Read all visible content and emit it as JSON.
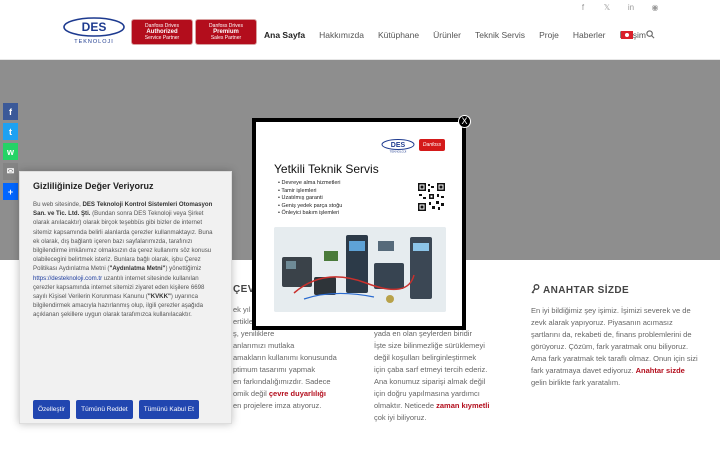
{
  "header": {
    "logo_text": "DES TEKNOLOJI",
    "badges": [
      {
        "line1": "Danfoss Drives",
        "line2": "Authorized",
        "line3": "Service Partner"
      },
      {
        "line1": "Danfoss Drives",
        "line2": "Premium",
        "line3": "Sales Partner"
      }
    ],
    "nav": [
      "Ana Sayfa",
      "Hakkımızda",
      "Kütüphane",
      "Ürünler",
      "Teknik Servis",
      "Proje",
      "Haberler",
      "İletişim"
    ],
    "active_nav": "Ana Sayfa",
    "social": [
      "f",
      "𝕏",
      "in",
      "rss"
    ]
  },
  "share": [
    "f",
    "t",
    "w",
    "✉",
    "+"
  ],
  "cookie": {
    "title": "Gizliliğinize Değer Veriyoruz",
    "p1a": "Bu web sitesinde, ",
    "p1b": "DES Teknoloji Kontrol Sistemleri Otomasyon San. ve Tic. Ltd. Şti.",
    "p1c": " (Bundan sonra DES Teknoloji veya Şirket olarak anılacaktır) olarak birçok teşebbüs gibi bizler de internet sitemiz kapsamında belirli alanlarda çerezler kullanmaktayız. Buna ek olarak, dış bağlantı içeren bazı sayfalarımızda, tarafınızı bilgilendirme imkânımız olmaksızın da çerez kullanımı söz konusu olabilecegini belirtmek isteriz. Bunlara bağlı olarak, işbu Çerez Politikası Aydınlatma Metni (",
    "p1d": "\"Aydınlatma Metni\"",
    "p1e": ") yönettiğimiz",
    "link": "https://desteknoloji.com.tr",
    "p2": " uzantılı internet sitesinde kullanılan çerezler kapsamında internet sitemizi ziyaret eden kişilere 6698 sayılı Kişisel Verilerin Korunması Kanunu (",
    "p2b": "\"KVKK\"",
    "p2c": ") uyarınca bilgilendirmek amacıyla hazırlanmış olup, ilgili çerezler aşağıda açıklanan şekillere uygun olarak tarafımızca kullanılacaktır.",
    "buttons": [
      "Özelleştir",
      "Tümünü Reddet",
      "Tümünü Kabul Et"
    ]
  },
  "modal": {
    "close": "X",
    "des_logo": "DES",
    "danfoss_logo": "Danfoss",
    "title": "Yetkili Teknik Servis",
    "items": [
      "Devreye alma hizmetleri",
      "Tamir işlemleri",
      "Uzatılmış garanti",
      "Geniş yedek parça stoğu",
      "Önleyici bakım işlemleri"
    ]
  },
  "columns": {
    "col1": {
      "title": "ÇEV",
      "lines": [
        "ek yıl",
        "ertikleri",
        "ş, yeniliklere",
        "anlarımızı mutlaka",
        "amakların kullanımı konusunda",
        "ptimum tasarımı yapmak",
        "en farkındalığımızdır. Sadece",
        "omik değil"
      ],
      "highlight": "çevre duyarlılığı",
      "tail": "en projelere imza atıyoruz."
    },
    "col2": {
      "title": "I",
      "lines": [
        "iz",
        "z",
        "yada en olan şeylerden biridir",
        "İşte size bilinmezliğe sürüklemeyi",
        "değil koşulları belirginleştirmek",
        "için çaba sarf etmeyi tercih ederiz.",
        "Ana konumuz siparişi almak değil",
        "için doğru yapılmasına yardımcı"
      ],
      "pre": "olmaktır. Neticede ",
      "highlight": "zaman kıymetli",
      "tail": "çok iyi biliyoruz."
    },
    "col3": {
      "title": "ANAHTAR SİZDE",
      "text": "En iyi bildiğimiz şey işimiz. İşimizi severek ve de zevk alarak yapıyoruz. Piyasanın acımasız şartlarını da, rekabeti de, finans problemlerini de görüyoruz. Çözüm, fark yaratmak onu biliyoruz. Ama fark yaratmak tek taraflı olmaz. Onun için sizi fark yaratmaya davet ediyoruz.",
      "highlight": "Anahtar sizde",
      "tail": " gelin birlikte fark yaratalım."
    }
  }
}
